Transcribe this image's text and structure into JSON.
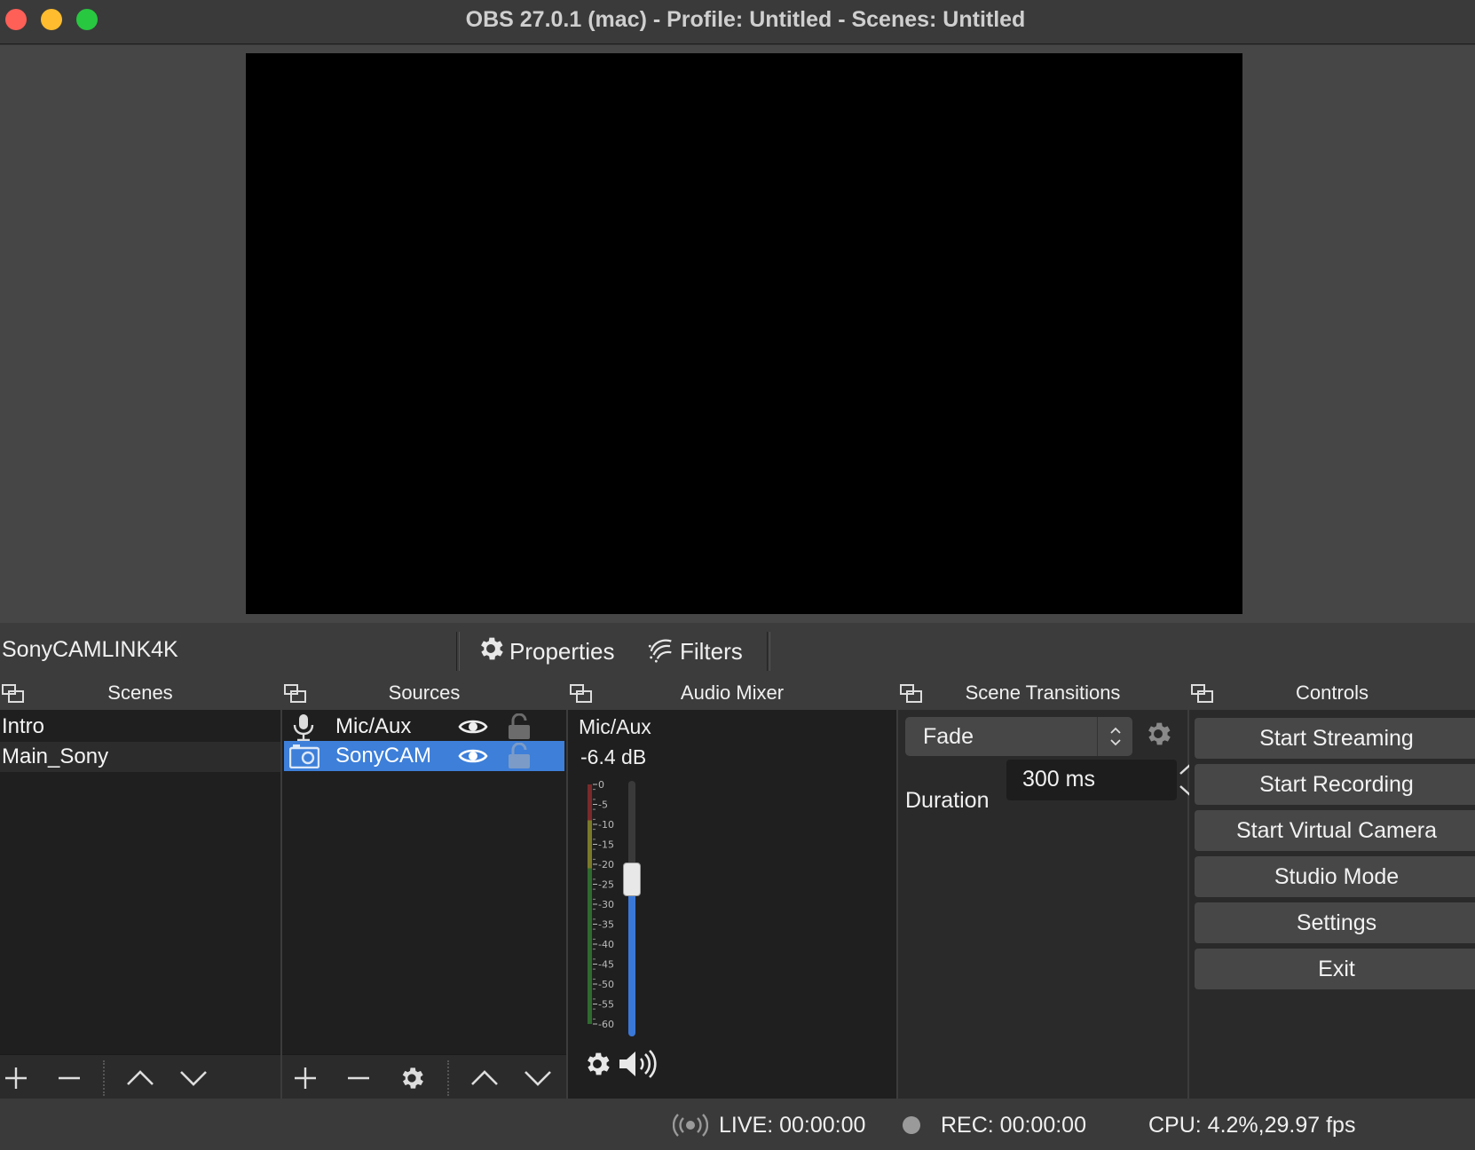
{
  "window": {
    "title": "OBS 27.0.1 (mac) - Profile: Untitled - Scenes: Untitled"
  },
  "context_bar": {
    "source_name": "SonyCAMLINK4K",
    "properties_label": "Properties",
    "filters_label": "Filters"
  },
  "scenes": {
    "title": "Scenes",
    "items": [
      {
        "label": "Intro"
      },
      {
        "label": "Main_Sony"
      }
    ]
  },
  "sources": {
    "title": "Sources",
    "items": [
      {
        "label": "Mic/Aux",
        "icon": "microphone-icon",
        "visible": true,
        "locked": false
      },
      {
        "label": "SonyCAM",
        "icon": "camera-icon",
        "visible": true,
        "locked": false,
        "selected": true
      }
    ]
  },
  "audio_mixer": {
    "title": "Audio Mixer",
    "channel_name": "Mic/Aux",
    "level": "-6.4 dB",
    "meter_ticks": [
      "0",
      "-5",
      "-10",
      "-15",
      "-20",
      "-25",
      "-30",
      "-35",
      "-40",
      "-45",
      "-50",
      "-55",
      "-60"
    ]
  },
  "scene_transitions": {
    "title": "Scene Transitions",
    "transition": "Fade",
    "duration_label": "Duration",
    "duration_value": "300 ms"
  },
  "controls": {
    "title": "Controls",
    "buttons": [
      {
        "label": "Start Streaming"
      },
      {
        "label": "Start Recording"
      },
      {
        "label": "Start Virtual Camera"
      },
      {
        "label": "Studio Mode"
      },
      {
        "label": "Settings"
      },
      {
        "label": "Exit"
      }
    ]
  },
  "status_bar": {
    "live": "LIVE: 00:00:00",
    "rec": "REC: 00:00:00",
    "cpu": "CPU: 4.2%,29.97 fps"
  },
  "colors": {
    "selection": "#3d7fd9",
    "accent_blue": "#3a78d8"
  }
}
